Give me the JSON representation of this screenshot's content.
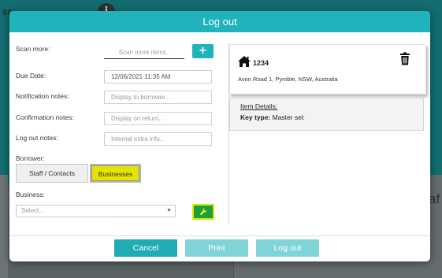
{
  "background": {
    "fragment_text": "SE",
    "circle_icon": "info-icon",
    "right_letter": "af"
  },
  "modal": {
    "title": "Log out",
    "colors": {
      "header": "#20b3bb",
      "primary_button": "#1facb3",
      "disabled_button": "#7fd4d8",
      "highlight": "#e3e500",
      "wrench_button": "#1b9f3a"
    }
  },
  "form": {
    "scan_more_label": "Scan more:",
    "scan_more_placeholder": "Scan more items..",
    "add_icon": "plus-icon",
    "due_date_label": "Due Date:",
    "due_date_value": "12/06/2021 11:35 AM",
    "notification_label": "Notification notes:",
    "notification_placeholder": "Display to borrower..",
    "confirmation_label": "Confirmation notes:",
    "confirmation_placeholder": "Display on return..",
    "logout_notes_label": "Log out notes:",
    "logout_notes_placeholder": "Internal extra info..",
    "borrower_label": "Borrower:",
    "borrower_options": [
      "Staff / Contacts",
      "Businesses"
    ],
    "borrower_selected": "Businesses",
    "business_label": "Business:",
    "business_select_placeholder": "Select...",
    "wrench_icon": "wrench-icon"
  },
  "item": {
    "icon": "home-icon",
    "number": "1234",
    "address": "Avon Road 1, Pymble, NSW, Australia",
    "delete_icon": "trash-icon",
    "details_title": "Item Details:",
    "key_type_label": "Key type:",
    "key_type_value": "Master set"
  },
  "footer": {
    "cancel_label": "Cancel",
    "print_label": "Print",
    "logout_label": "Log out"
  }
}
